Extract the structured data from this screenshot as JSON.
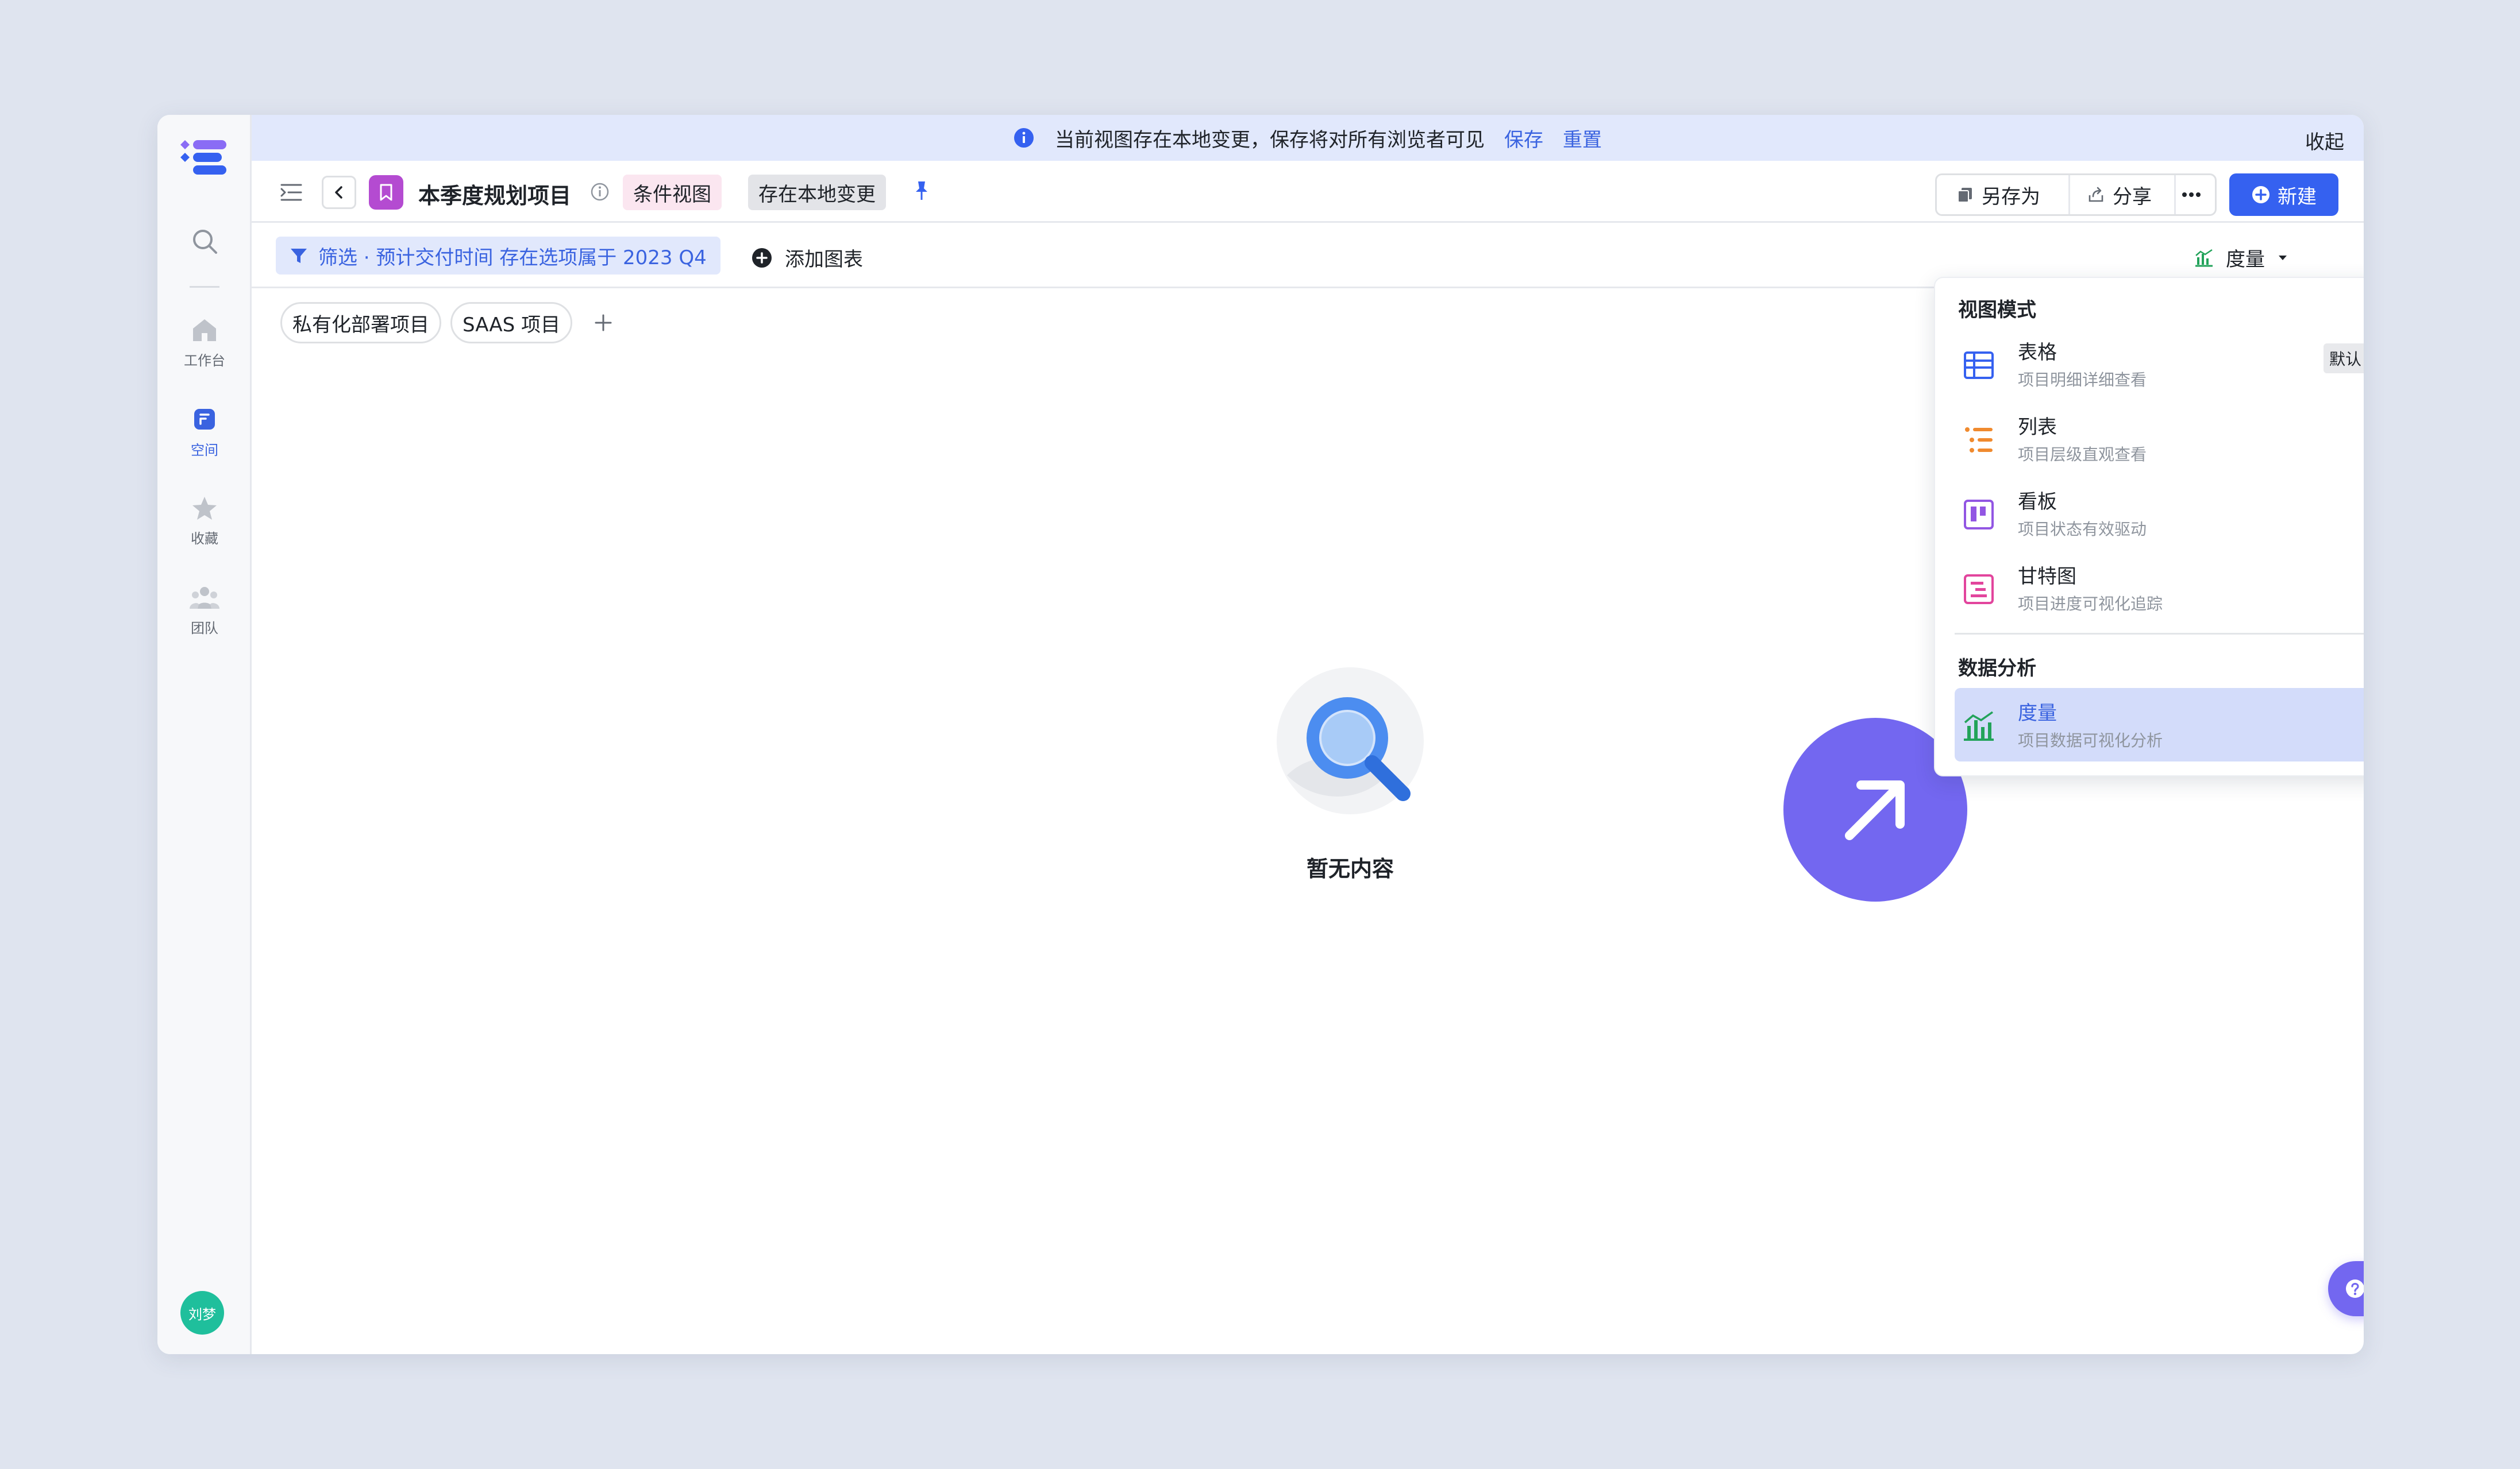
{
  "rail": {
    "items": [
      {
        "label": "工作台",
        "icon": "home-icon"
      },
      {
        "label": "空间",
        "icon": "space-icon"
      },
      {
        "label": "收藏",
        "icon": "star-icon"
      },
      {
        "label": "团队",
        "icon": "team-icon"
      }
    ],
    "avatar": "刘梦"
  },
  "banner": {
    "message": "当前视图存在本地变更，保存将对所有浏览者可见",
    "save": "保存",
    "reset": "重置",
    "collapse": "收起"
  },
  "toolbar": {
    "title": "本季度规划项目",
    "tag_condition": "条件视图",
    "tag_local": "存在本地变更",
    "save_as": "另存为",
    "share": "分享",
    "new": "新建"
  },
  "filterbar": {
    "filter": "筛选 · 预计交付时间 存在选项属于 2023 Q4",
    "add_chart": "添加图表",
    "measure": "度量"
  },
  "tabs": [
    "私有化部署项目",
    "SAAS 项目"
  ],
  "empty": {
    "text": "暂无内容"
  },
  "dropdown": {
    "section_view": "视图模式",
    "section_data": "数据分析",
    "items": [
      {
        "name": "表格",
        "desc": "项目明细详细查看",
        "badge": "默认"
      },
      {
        "name": "列表",
        "desc": "项目层级直观查看"
      },
      {
        "name": "看板",
        "desc": "项目状态有效驱动"
      },
      {
        "name": "甘特图",
        "desc": "项目进度可视化追踪"
      },
      {
        "name": "度量",
        "desc": "项目数据可视化分析"
      }
    ]
  },
  "help": "帮助",
  "colors": {
    "accent": "#3561f0",
    "link": "#3a63e0",
    "banner_bg": "#e1e8fc",
    "purple": "#7367f0"
  }
}
